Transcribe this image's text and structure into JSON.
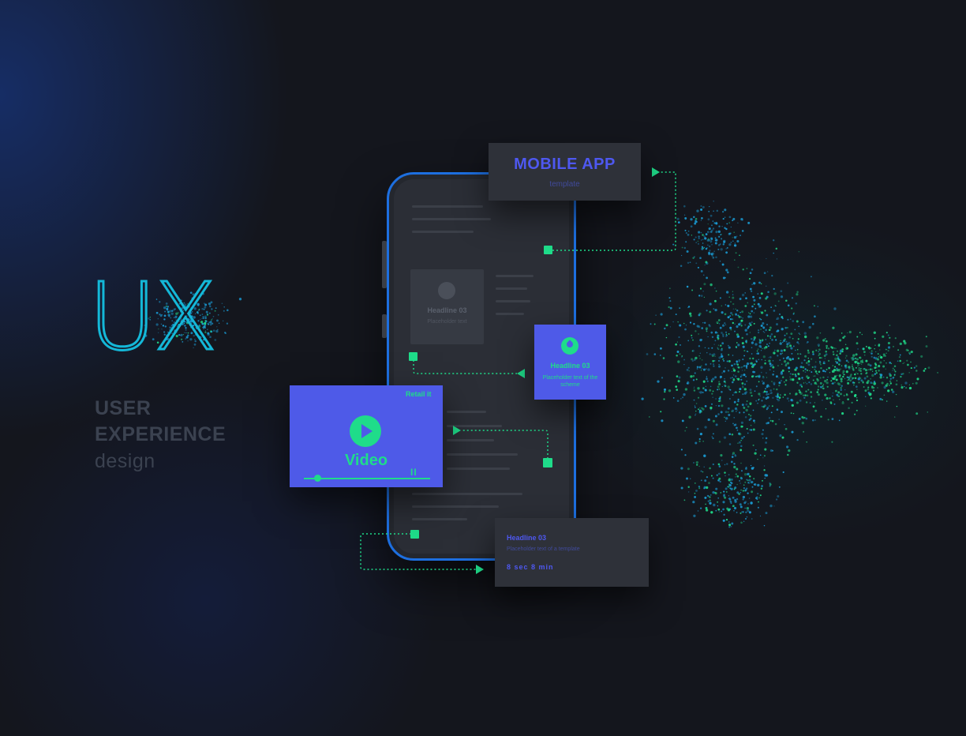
{
  "hero": {
    "title": "UX",
    "line1": "USER",
    "line2": "EXPERIENCE",
    "line3": "design"
  },
  "phone_card": {
    "title": "Headline 03",
    "subtitle": "Placeholder text"
  },
  "mobile_card": {
    "title": "MOBILE APP",
    "subtitle": "template"
  },
  "video_card": {
    "tag": "Retail it",
    "label": "Video",
    "controls": "II"
  },
  "feature_card": {
    "title": "Headline 03",
    "subtitle": "Placeholder text of the scheme"
  },
  "info_card": {
    "title": "Headline 03",
    "subtitle": "Placeholder text of a template",
    "meta": "8 sec 8 min"
  },
  "colors": {
    "background": "#14161d",
    "accent_blue": "#4e5ae8",
    "accent_green": "#1fdc8a",
    "cyan": "#14b8d8",
    "muted_text": "#3b4250"
  }
}
